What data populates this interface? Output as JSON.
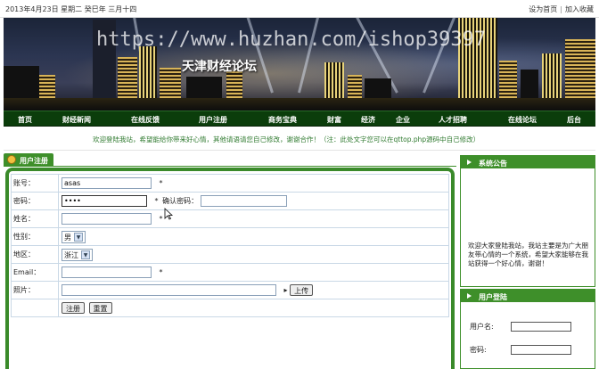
{
  "topbar": {
    "date": "2013年4月23日 星期二 癸巳年 三月十四",
    "set_home": "设为首页",
    "separator": "|",
    "add_favorite": "加入收藏"
  },
  "banner": {
    "watermark": "https://www.huzhan.com/ishop39397",
    "site_name": "天津财经论坛"
  },
  "nav": {
    "items": [
      "首页",
      "财经新闻",
      "在线反馈",
      "用户注册",
      "商务宝典",
      "财富",
      "经济",
      "企业",
      "人才招聘",
      "在线论坛",
      "后台"
    ]
  },
  "notice": {
    "text": "欢迎登陆我站，希望能给你带来好心情，其他请语请您自己修改，谢谢合作！（注：此处文字您可以在qttop.php源码中自己修改）"
  },
  "register_panel": {
    "title": "用户注册",
    "labels": {
      "account": "账号：",
      "password": "密码：",
      "confirm_password": "确认密码：",
      "name": "姓名：",
      "gender": "性别：",
      "region": "地区：",
      "email": "Email：",
      "photo": "照片："
    },
    "values": {
      "account": "asas",
      "password": "••••",
      "gender": "男",
      "region": "浙江"
    },
    "required_mark": "*",
    "upload_button": "上传",
    "register_button": "注册",
    "reset_button": "重置"
  },
  "sidebar": {
    "announcement_title": "系统公告",
    "announcement_text": "欢迎大家登陆我站，我站主要是为广大朋友带心情的一个系统，希望大家能够在我站获得一个好心情，谢谢！",
    "login_title": "用户登陆",
    "username_label": "用户名:",
    "password_label": "密码:"
  },
  "colors": {
    "nav_bg": "#0b3d0b",
    "panel_green": "#3e8f2a",
    "notice_text": "#2f7a2f"
  }
}
